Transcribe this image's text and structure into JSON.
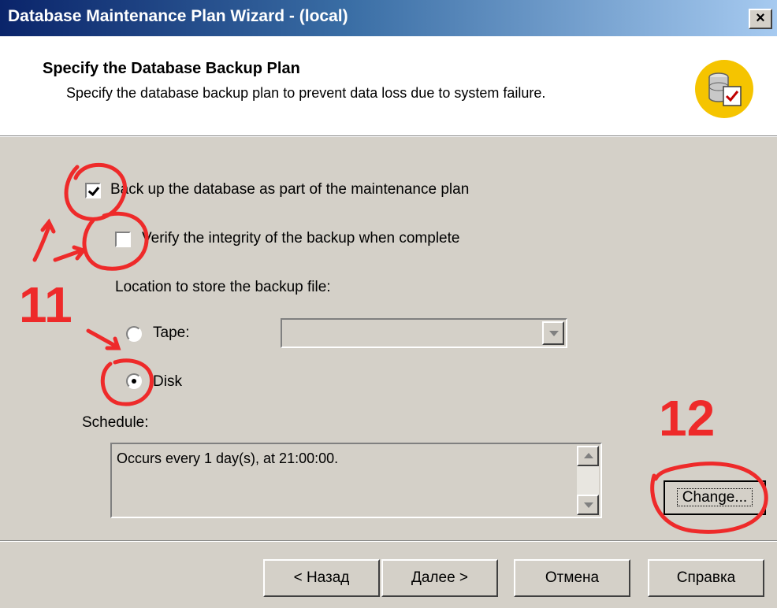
{
  "titlebar": {
    "title": "Database Maintenance Plan Wizard - (local)",
    "close": "×"
  },
  "header": {
    "title": "Specify the Database Backup Plan",
    "subtitle": "Specify the database backup plan to prevent data loss due to system failure."
  },
  "options": {
    "backup_label": "Back up the database as part of the maintenance plan",
    "backup_checked": true,
    "verify_label": "Verify the integrity of the backup when complete",
    "verify_checked": false,
    "location_label": "Location to store the backup file:",
    "tape_label": "Tape:",
    "tape_value": "",
    "disk_label": "Disk",
    "selected_location": "Disk"
  },
  "schedule": {
    "label": "Schedule:",
    "text": "Occurs every 1 day(s), at 21:00:00.",
    "change_label": "Change..."
  },
  "footer": {
    "back_label": "< Назад",
    "next_label": "Далее >",
    "cancel_label": "Отмена",
    "help_label": "Справка"
  },
  "annotations": {
    "label_11": "11",
    "label_12": "12",
    "color": "#ee2a2a"
  }
}
